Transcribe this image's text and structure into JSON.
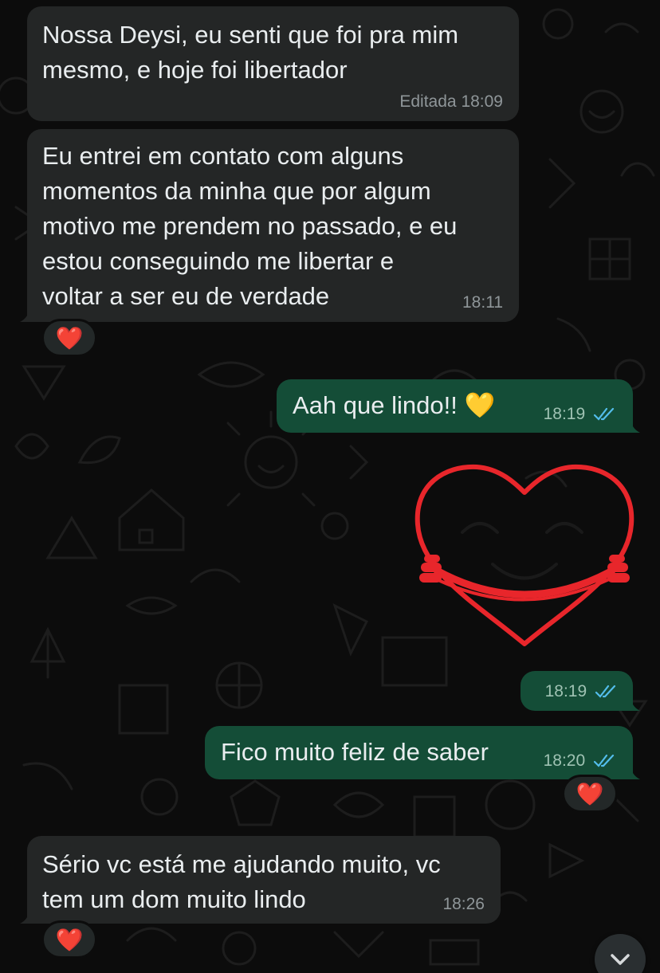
{
  "messages": [
    {
      "id": "m1",
      "direction": "incoming",
      "text": "Nossa Deysi, eu senti que foi pra mim\nmesmo, e hoje foi libertador",
      "edited_label": "Editada",
      "time": "18:09"
    },
    {
      "id": "m2",
      "direction": "incoming",
      "text": "Eu entrei em contato com alguns\nmomentos da minha que por algum\nmotivo me prendem no passado, e eu\nestou conseguindo me libertar e\nvoltar a ser eu de verdade",
      "time": "18:11",
      "reaction": "❤️"
    },
    {
      "id": "m3",
      "direction": "outgoing",
      "text": "Aah que lindo!! 💛",
      "time": "18:19",
      "status": "read"
    },
    {
      "id": "m4",
      "direction": "outgoing",
      "type": "sticker",
      "sticker": "heart-hug-sticker",
      "time": "18:19",
      "status": "read"
    },
    {
      "id": "m5",
      "direction": "outgoing",
      "text": "Fico muito feliz de saber",
      "time": "18:20",
      "status": "read",
      "reaction": "❤️"
    },
    {
      "id": "m6",
      "direction": "incoming",
      "text": "Sério vc está me ajudando muito, vc\ntem um dom muito lindo",
      "time": "18:26",
      "reaction": "❤️"
    }
  ],
  "colors": {
    "incoming_bubble": "#242626",
    "outgoing_bubble": "#144d37",
    "read_ticks": "#53bdeb",
    "heart_sticker": "#e8262b"
  },
  "icons": {
    "scroll_down": "chevron-down-icon",
    "read_receipt": "double-check-icon"
  }
}
